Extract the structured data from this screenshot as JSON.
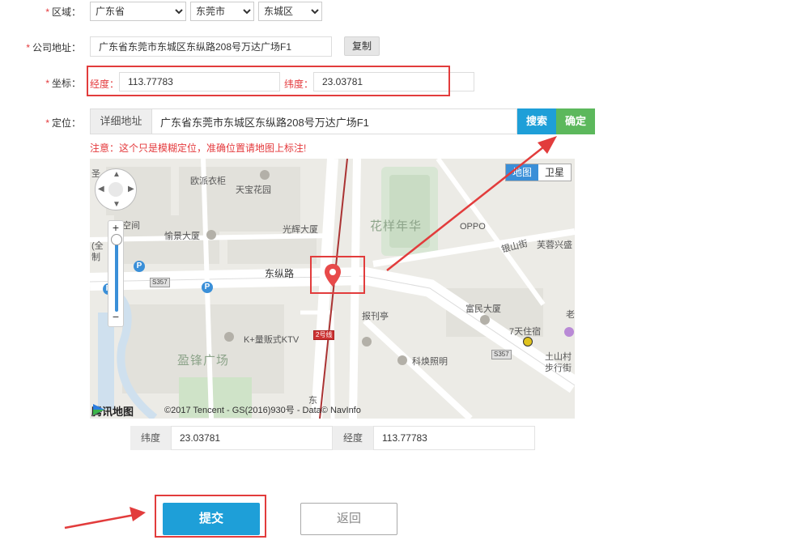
{
  "region": {
    "label": "区域：",
    "province": "广东省",
    "city": "东莞市",
    "district": "东城区"
  },
  "company_address": {
    "label": "公司地址：",
    "value": "广东省东莞市东城区东纵路208号万达广场F1",
    "copy_button": "复制"
  },
  "coordinates": {
    "label": "坐标：",
    "lng_label": "经度：",
    "lng_value": "113.77783",
    "lat_label": "纬度：",
    "lat_value": "23.03781"
  },
  "locate": {
    "label": "定位：",
    "detail_label": "详细地址",
    "detail_value": "广东省东莞市东城区东纵路208号万达广场F1",
    "search_button": "搜索",
    "confirm_button": "确定",
    "notice": "注意：这个只是模糊定位，准确位置请地图上标注!"
  },
  "map": {
    "type_map": "地图",
    "type_satellite": "卫星",
    "logo_text": "腾讯地图",
    "copyright": "©2017 Tencent - GS(2016)930号 - Data© NavInfo",
    "labels": {
      "oupai": "欧派衣柜",
      "tianbao": "天宝花园",
      "yufu": "愉景大厦",
      "guanghui": "光辉大厦",
      "huayang": "花样年华",
      "oppo": "OPPO",
      "yinshan": "银山街",
      "furong": "芙蓉兴盛",
      "dongzong": "东纵路",
      "fumin": "富民大厦",
      "baokanting": "报刊亭",
      "qitian": "7天住宿",
      "ktv": "K+量贩式KTV",
      "yingfeng": "盈锋广场",
      "kehuan": "科焕照明",
      "tushan": "土山村",
      "buxing": "步行街",
      "kongjian": "空间",
      "s357a": "S357",
      "s357b": "S357",
      "line2": "2号线",
      "sheng": "圣",
      "lao": "老",
      "quan": "(全",
      "li": "制",
      "dong": "东"
    }
  },
  "coords_display": {
    "lat_label": "纬度",
    "lat_value": "23.03781",
    "lng_label": "经度",
    "lng_value": "113.77783"
  },
  "actions": {
    "submit": "提交",
    "back": "返回"
  },
  "colors": {
    "accent_blue": "#1e9fd8",
    "confirm_green": "#5cb85c",
    "required_red": "#e4393c",
    "highlight_red": "#e23c3c",
    "map_pin": "#e84a4a"
  }
}
